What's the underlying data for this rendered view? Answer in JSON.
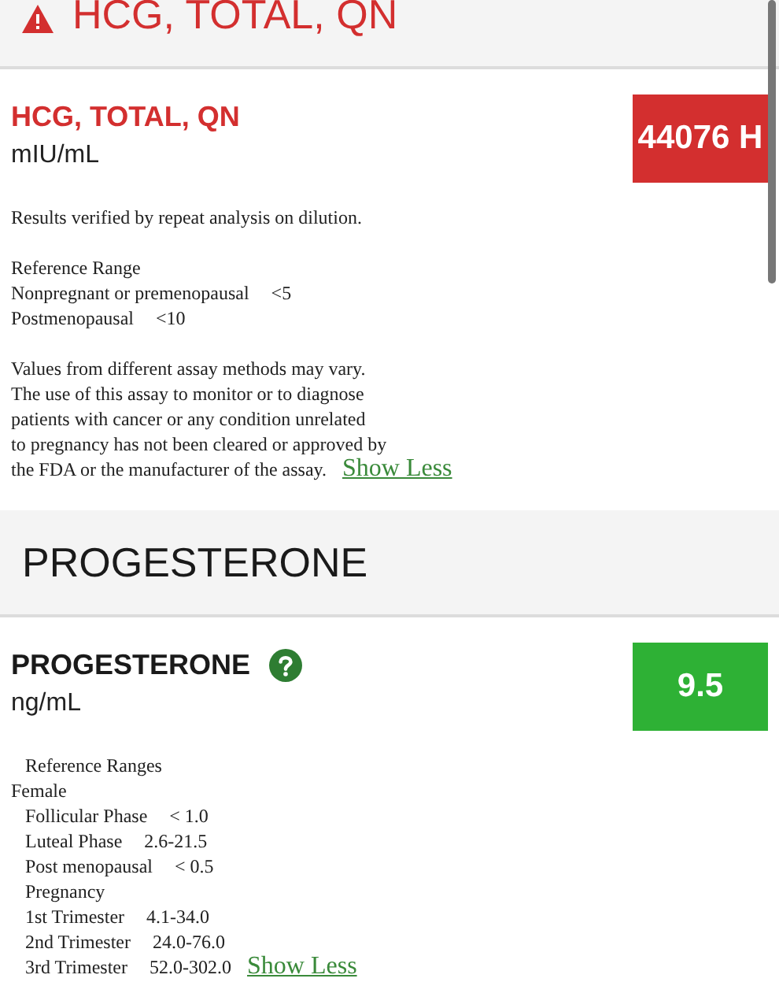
{
  "sections": [
    {
      "header": {
        "title": "HCG, TOTAL, QN",
        "alert": true
      },
      "result": {
        "name": "HCG, TOTAL, QN",
        "abnormal": true,
        "help": false,
        "unit": "mIU/mL",
        "value": "44076 H",
        "notes": [
          {
            "lines": [
              {
                "text": "Results verified by repeat analysis on dilution."
              }
            ]
          },
          {
            "lines": [
              {
                "text": "Reference Range"
              },
              {
                "text": "Nonpregnant or premenopausal",
                "value": "<5"
              },
              {
                "text": "Postmenopausal",
                "value": "<10"
              }
            ]
          },
          {
            "lines": [
              {
                "text": "Values from different assay methods may vary."
              },
              {
                "text": "The use of this assay to monitor or to diagnose"
              },
              {
                "text": "patients with cancer or any condition unrelated"
              },
              {
                "text": "to pregnancy has not been cleared or approved by"
              },
              {
                "text": "the FDA or the manufacturer of the assay."
              }
            ]
          }
        ],
        "toggle": "Show Less"
      }
    },
    {
      "header": {
        "title": "PROGESTERONE",
        "alert": false
      },
      "result": {
        "name": "PROGESTERONE",
        "abnormal": false,
        "help": true,
        "unit": "ng/mL",
        "value": "9.5",
        "notes": [
          {
            "heading": "Reference Ranges",
            "lines": [
              {
                "text": "Female",
                "children": [
                  {
                    "text": "Follicular Phase",
                    "value": "< 1.0"
                  },
                  {
                    "text": "Luteal Phase",
                    "value": "2.6-21.5"
                  },
                  {
                    "text": "Post menopausal",
                    "value": "< 0.5"
                  },
                  {
                    "text": "Pregnancy"
                  },
                  {
                    "text": "1st Trimester",
                    "value": "4.1-34.0"
                  },
                  {
                    "text": "2nd Trimester",
                    "value": "24.0-76.0"
                  },
                  {
                    "text": "3rd Trimester",
                    "value": "52.0-302.0"
                  }
                ]
              }
            ]
          }
        ],
        "toggle": "Show Less"
      }
    }
  ]
}
